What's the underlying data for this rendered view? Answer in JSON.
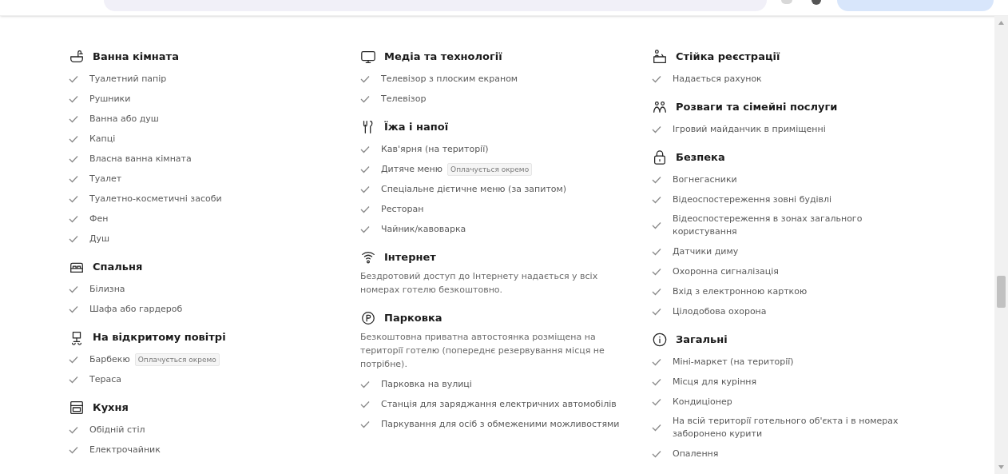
{
  "columns": [
    {
      "sections": [
        {
          "title": "Ванна кімната",
          "items": [
            {
              "label": "Туалетний папір"
            },
            {
              "label": "Рушники"
            },
            {
              "label": "Ванна або душ"
            },
            {
              "label": "Капці"
            },
            {
              "label": "Власна ванна кімната"
            },
            {
              "label": "Туалет"
            },
            {
              "label": "Туалетно-косметичні засоби"
            },
            {
              "label": "Фен"
            },
            {
              "label": "Душ"
            }
          ]
        },
        {
          "title": "Спальня",
          "items": [
            {
              "label": "Білизна"
            },
            {
              "label": "Шафа або гардероб"
            }
          ]
        },
        {
          "title": "На відкритому повітрі",
          "items": [
            {
              "label": "Барбекю",
              "badge": "Оплачується окремо"
            },
            {
              "label": "Тераса"
            }
          ]
        },
        {
          "title": "Кухня",
          "items": [
            {
              "label": "Обідній стіл"
            },
            {
              "label": "Електрочайник"
            }
          ]
        }
      ]
    },
    {
      "sections": [
        {
          "title": "Медіа та технології",
          "items": [
            {
              "label": "Телевізор з плоским екраном"
            },
            {
              "label": "Телевізор"
            }
          ]
        },
        {
          "title": "Їжа і напої",
          "items": [
            {
              "label": "Кав'ярня (на території)"
            },
            {
              "label": "Дитяче меню",
              "badge": "Оплачується окремо"
            },
            {
              "label": "Спеціальне дієтичне меню (за запитом)"
            },
            {
              "label": "Ресторан"
            },
            {
              "label": "Чайник/кавоварка"
            }
          ]
        },
        {
          "title": "Інтернет",
          "description": "Бездротовий доступ до Інтернету надається у всіх номерах готелю безкоштовно."
        },
        {
          "title": "Парковка",
          "description": "Безкоштовна приватна автостоянка розміщена на території готелю (попереднє резервування місця не потрібне).",
          "items": [
            {
              "label": "Парковка на вулиці"
            },
            {
              "label": "Станція для заряджання електричних автомобілів"
            },
            {
              "label": "Паркування для осіб з обмеженими можливостями"
            }
          ]
        }
      ]
    },
    {
      "sections": [
        {
          "title": "Стійка реєстрації",
          "items": [
            {
              "label": "Надається рахунок"
            }
          ]
        },
        {
          "title": "Розваги та сімейні послуги",
          "items": [
            {
              "label": "Ігровий майданчик в приміщенні"
            }
          ]
        },
        {
          "title": "Безпека",
          "items": [
            {
              "label": "Вогнегасники"
            },
            {
              "label": "Відеоспостереження зовні будівлі"
            },
            {
              "label": "Відеоспостереження в зонах загального користування"
            },
            {
              "label": "Датчики диму"
            },
            {
              "label": "Охоронна сигналізація"
            },
            {
              "label": "Вхід з електронною карткою"
            },
            {
              "label": "Цілодобова охорона"
            }
          ]
        },
        {
          "title": "Загальні",
          "items": [
            {
              "label": "Міні-маркет (на території)"
            },
            {
              "label": "Місця для куріння"
            },
            {
              "label": "Кондиціонер"
            },
            {
              "label": "На всій території готельного об'єкта і в номерах заборонено курити"
            },
            {
              "label": "Опалення"
            }
          ]
        }
      ]
    }
  ]
}
